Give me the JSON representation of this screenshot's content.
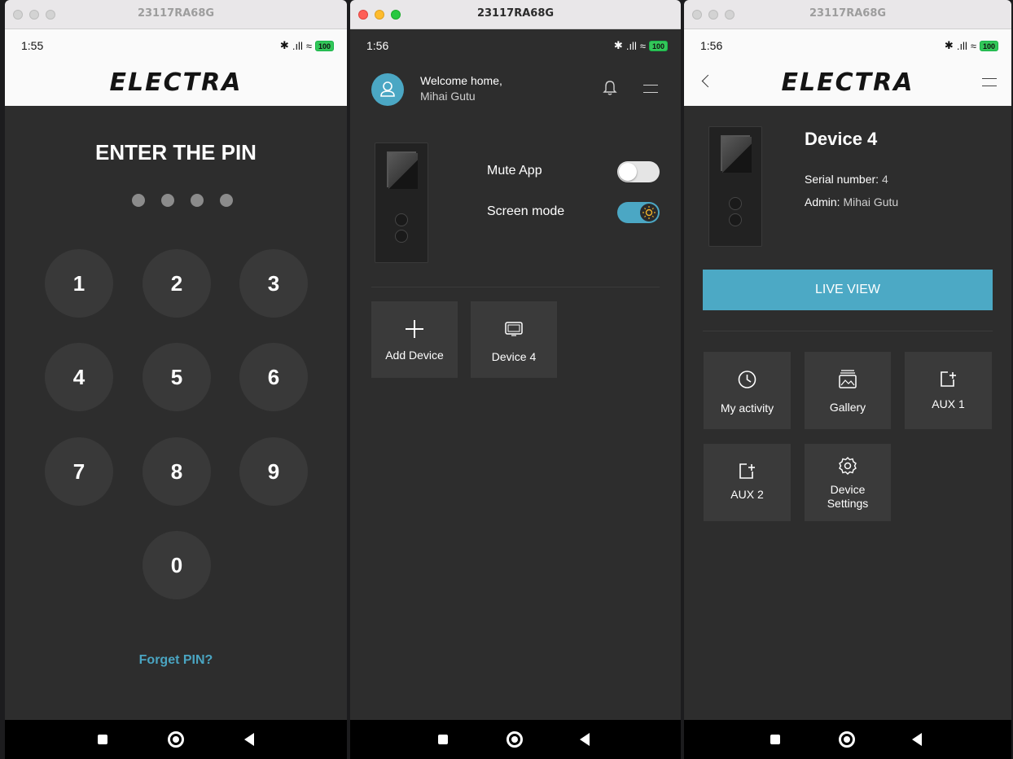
{
  "device_model": "23117RA68G",
  "brand": "ELECTRA",
  "screen_pin": {
    "time": "1:55",
    "battery": "100",
    "title": "ENTER THE PIN",
    "keys": [
      "1",
      "2",
      "3",
      "4",
      "5",
      "6",
      "7",
      "8",
      "9",
      "0"
    ],
    "forget_label": "Forget PIN?"
  },
  "screen_home": {
    "time": "1:56",
    "battery": "100",
    "welcome_line1": "Welcome home,",
    "welcome_line2": "Mihai Gutu",
    "mute_label": "Mute App",
    "mute_on": false,
    "screen_mode_label": "Screen mode",
    "screen_mode_on": true,
    "tiles": [
      {
        "label": "Add Device",
        "icon": "plus-icon"
      },
      {
        "label": "Device 4",
        "icon": "monitor-icon"
      }
    ]
  },
  "screen_device": {
    "time": "1:56",
    "battery": "100",
    "device_name": "Device 4",
    "serial_label": "Serial number:",
    "serial_value": "4",
    "admin_label": "Admin:",
    "admin_value": "Mihai Gutu",
    "live_view": "LIVE VIEW",
    "tiles": [
      {
        "label": "My activity",
        "icon": "clock-icon"
      },
      {
        "label": "Gallery",
        "icon": "gallery-icon"
      },
      {
        "label": "AUX 1",
        "icon": "aux-icon"
      },
      {
        "label": "AUX 2",
        "icon": "aux-icon"
      },
      {
        "label": "Device\nSettings",
        "icon": "gear-icon"
      }
    ]
  },
  "colors": {
    "accent": "#4ba7c4",
    "background": "#2d2d2d",
    "tile": "#3a3a3a"
  }
}
